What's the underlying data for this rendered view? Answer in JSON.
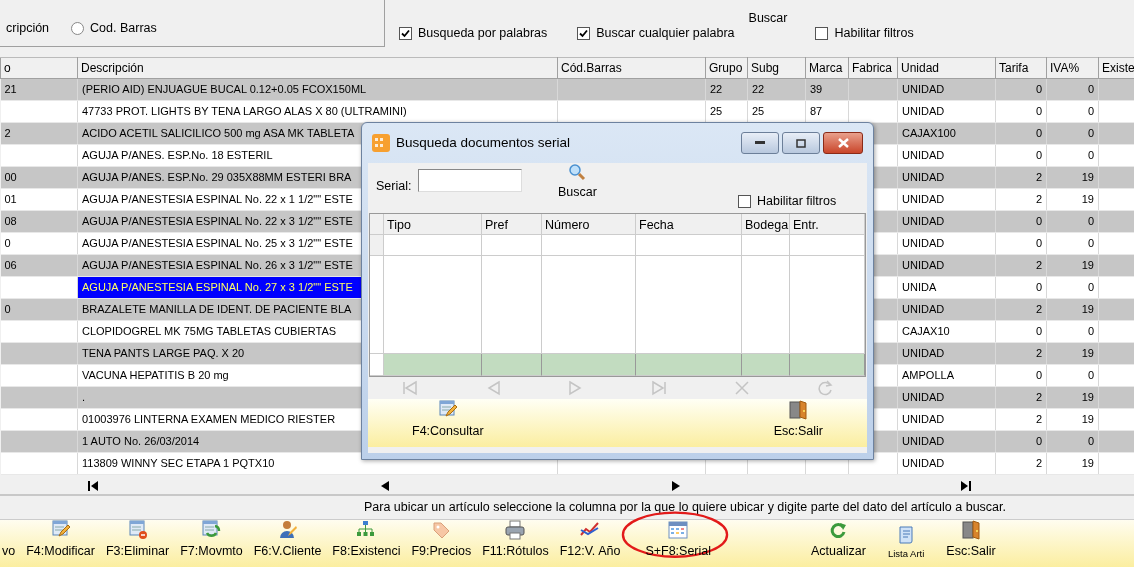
{
  "search_panel": {
    "partial_label": "cripción",
    "radio": {
      "label": "Cod. Barras",
      "selected": false
    },
    "checkboxes": [
      {
        "label": "Busqueda por palabras",
        "checked": true
      },
      {
        "label": "Buscar cualquier palabra",
        "checked": true
      }
    ],
    "search_button": "Buscar",
    "filter_checkbox": {
      "label": "Habilitar filtros",
      "checked": false
    }
  },
  "table": {
    "columns": [
      "o",
      "Descripción",
      "Cód.Barras",
      "Grupo",
      "Subg",
      "Marca",
      "Fabrica",
      "Unidad",
      "Tarifa",
      "IVA%",
      "Existe"
    ],
    "rows": [
      {
        "code": "21",
        "description": "(PERIO AID) ENJUAGUE BUCAL 0.12+0.05 FCOX150ML",
        "grupo": "22",
        "subg": "22",
        "marca": "39",
        "unidad": "UNIDAD",
        "tarifa": "0",
        "iva": "0",
        "selected": false
      },
      {
        "description": "47733 PROT. LIGHTS BY TENA LARGO ALAS X 80 (ULTRAMINI)",
        "grupo": "25",
        "subg": "25",
        "marca": "87",
        "unidad": "UNIDAD",
        "tarifa": "0",
        "iva": "0",
        "selected": false
      },
      {
        "code": "2",
        "description": "ACIDO ACETIL SALICILICO 500 mg ASA MK  TABLETA",
        "unidad": "CAJAX100",
        "tarifa": "0",
        "iva": "0",
        "selected": false
      },
      {
        "description": "AGUJA P/ANES. ESP.No. 18 ESTERIL",
        "unidad": "UNIDAD",
        "tarifa": "0",
        "iva": "0",
        "selected": false
      },
      {
        "code": "00",
        "description": "AGUJA P/ANES. ESP.No. 29  035X88MM ESTERI BRA",
        "unidad": "UNIDAD",
        "tarifa": "2",
        "iva": "19",
        "selected": false
      },
      {
        "code": "01",
        "description": "AGUJA P/ANESTESIA ESPINAL No. 22 x 1 1/2\"\" ESTE",
        "unidad": "UNIDAD",
        "tarifa": "2",
        "iva": "19",
        "selected": false
      },
      {
        "code": "08",
        "description": "AGUJA P/ANESTESIA ESPINAL No. 22 x 3 1/2\"\" ESTE",
        "unidad": "UNIDAD",
        "tarifa": "0",
        "iva": "0",
        "selected": false
      },
      {
        "code": "0",
        "description": "AGUJA P/ANESTESIA ESPINAL No. 25 x 3 1/2\"\" ESTE",
        "unidad": "UNIDAD",
        "tarifa": "0",
        "iva": "0",
        "selected": false
      },
      {
        "code": "06",
        "description": "AGUJA P/ANESTESIA ESPINAL No. 26 x 3 1/2\"\" ESTE",
        "unidad": "UNIDAD",
        "tarifa": "2",
        "iva": "19",
        "selected": false
      },
      {
        "description": "AGUJA P/ANESTESIA ESPINAL No. 27 x 3 1/2\"\" ESTE",
        "unidad": "UNIDA",
        "tarifa": "0",
        "iva": "0",
        "selected": true
      },
      {
        "code": "0",
        "description": "BRAZALETE MANILLA DE IDENT. DE PACIENTE BLA",
        "unidad": "UNIDAD",
        "tarifa": "2",
        "iva": "19",
        "selected": false
      },
      {
        "description": "CLOPIDOGREL MK 75MG TABLETAS CUBIERTAS",
        "unidad": "CAJAX10",
        "tarifa": "0",
        "iva": "0",
        "selected": false
      },
      {
        "description": "TENA PANTS LARGE PAQ. X 20",
        "unidad": "UNIDAD",
        "tarifa": "2",
        "iva": "19",
        "selected": false
      },
      {
        "description": "VACUNA HEPATITIS B 20 mg",
        "unidad": "AMPOLLA",
        "tarifa": "0",
        "iva": "0",
        "selected": false
      },
      {
        "description": ".",
        "unidad": "UNIDAD",
        "tarifa": "2",
        "iva": "19",
        "selected": false
      },
      {
        "description": "01003976 LINTERNA EXAMEN MEDICO RIESTER",
        "unidad": "UNIDAD",
        "tarifa": "2",
        "iva": "19",
        "selected": false
      },
      {
        "description": "1 AUTO No. 26/03/2014",
        "unidad": "UNIDAD",
        "tarifa": "0",
        "iva": "0",
        "selected": false
      },
      {
        "description": "113809 WINNY SEC ETAPA 1 PQTX10",
        "unidad": "UNIDAD",
        "tarifa": "2",
        "iva": "19",
        "selected": false
      }
    ]
  },
  "status_message": "Para ubicar un artículo seleccione la columna por la que lo quiere ubicar y digite parte del dato del artículo a buscar.",
  "toolbar": {
    "left": [
      "vo",
      "F4:Modificar",
      "F3:Eliminar",
      "F7:Movmto",
      "F6:V.Cliente",
      "F8:Existenci",
      "F9:Precios",
      "F11:Rótulos",
      "F12:V. Año",
      "S+F8:Serial"
    ],
    "right": [
      "Actualizar",
      "Lista Arti",
      "Esc:Salir"
    ]
  },
  "dialog": {
    "title": "Busqueda documentos serial",
    "serial_label": "Serial:",
    "search_button": "Buscar",
    "filter_checkbox": {
      "label": "Habilitar filtros",
      "checked": false
    },
    "columns": [
      "Tipo",
      "Pref",
      "Número",
      "Fecha",
      "Bodega",
      "Entr."
    ],
    "navigator": {
      "disabled": true
    },
    "buttons": [
      "F4:Consultar",
      "Esc:Salir"
    ]
  }
}
